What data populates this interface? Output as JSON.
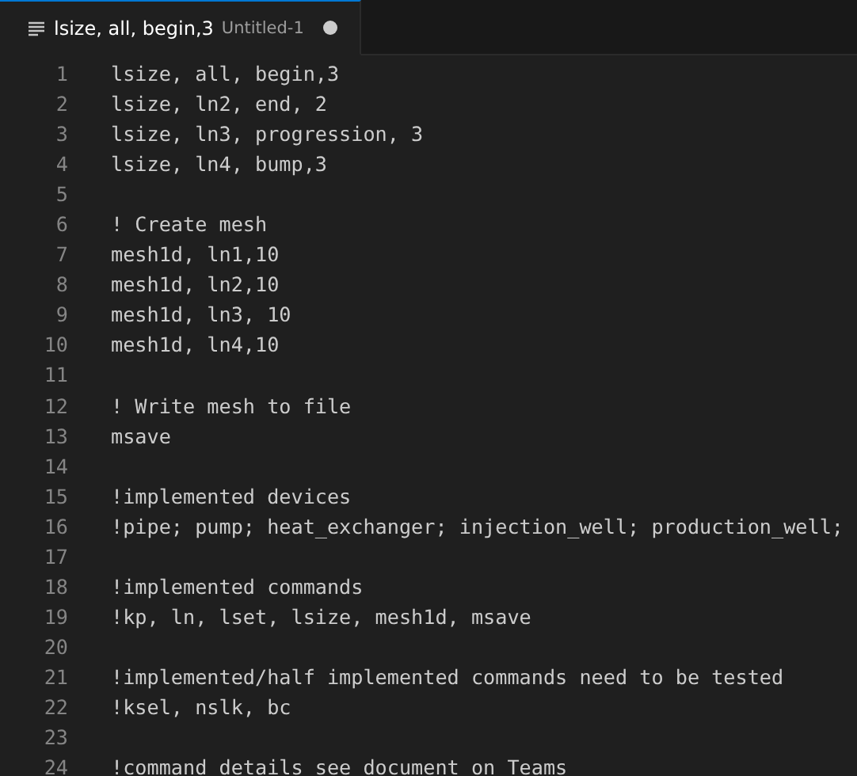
{
  "tabs": [
    {
      "title": "lsize, all, begin,3",
      "description": "Untitled-1",
      "selected": true,
      "modified": true
    }
  ],
  "editor": {
    "lines": [
      {
        "number": "1",
        "text": "lsize, all, begin,3"
      },
      {
        "number": "2",
        "text": "lsize, ln2, end, 2"
      },
      {
        "number": "3",
        "text": "lsize, ln3, progression, 3"
      },
      {
        "number": "4",
        "text": "lsize, ln4, bump,3"
      },
      {
        "number": "5"
      },
      {
        "number": "6",
        "text": "! Create mesh"
      },
      {
        "number": "7",
        "text": "mesh1d, ln1,10"
      },
      {
        "number": "8",
        "text": "mesh1d, ln2,10"
      },
      {
        "number": "9",
        "text": "mesh1d, ln3, 10"
      },
      {
        "number": "10",
        "text": "mesh1d, ln4,10"
      },
      {
        "number": "11"
      },
      {
        "number": "12",
        "text": "! Write mesh to file"
      },
      {
        "number": "13",
        "text": "msave"
      },
      {
        "number": "14"
      },
      {
        "number": "15",
        "text": "!implemented devices"
      },
      {
        "number": "16",
        "text": "!pipe; pump; heat_exchanger; injection_well; production_well;"
      },
      {
        "number": "17"
      },
      {
        "number": "18",
        "text": "!implemented commands"
      },
      {
        "number": "19",
        "text": "!kp, ln, lset, lsize, mesh1d, msave"
      },
      {
        "number": "20"
      },
      {
        "number": "21",
        "text": "!implemented/half implemented commands need to be tested"
      },
      {
        "number": "22",
        "text": "!ksel, nslk, bc"
      },
      {
        "number": "23"
      },
      {
        "number": "24",
        "text": "!command details see document on Teams"
      }
    ]
  }
}
